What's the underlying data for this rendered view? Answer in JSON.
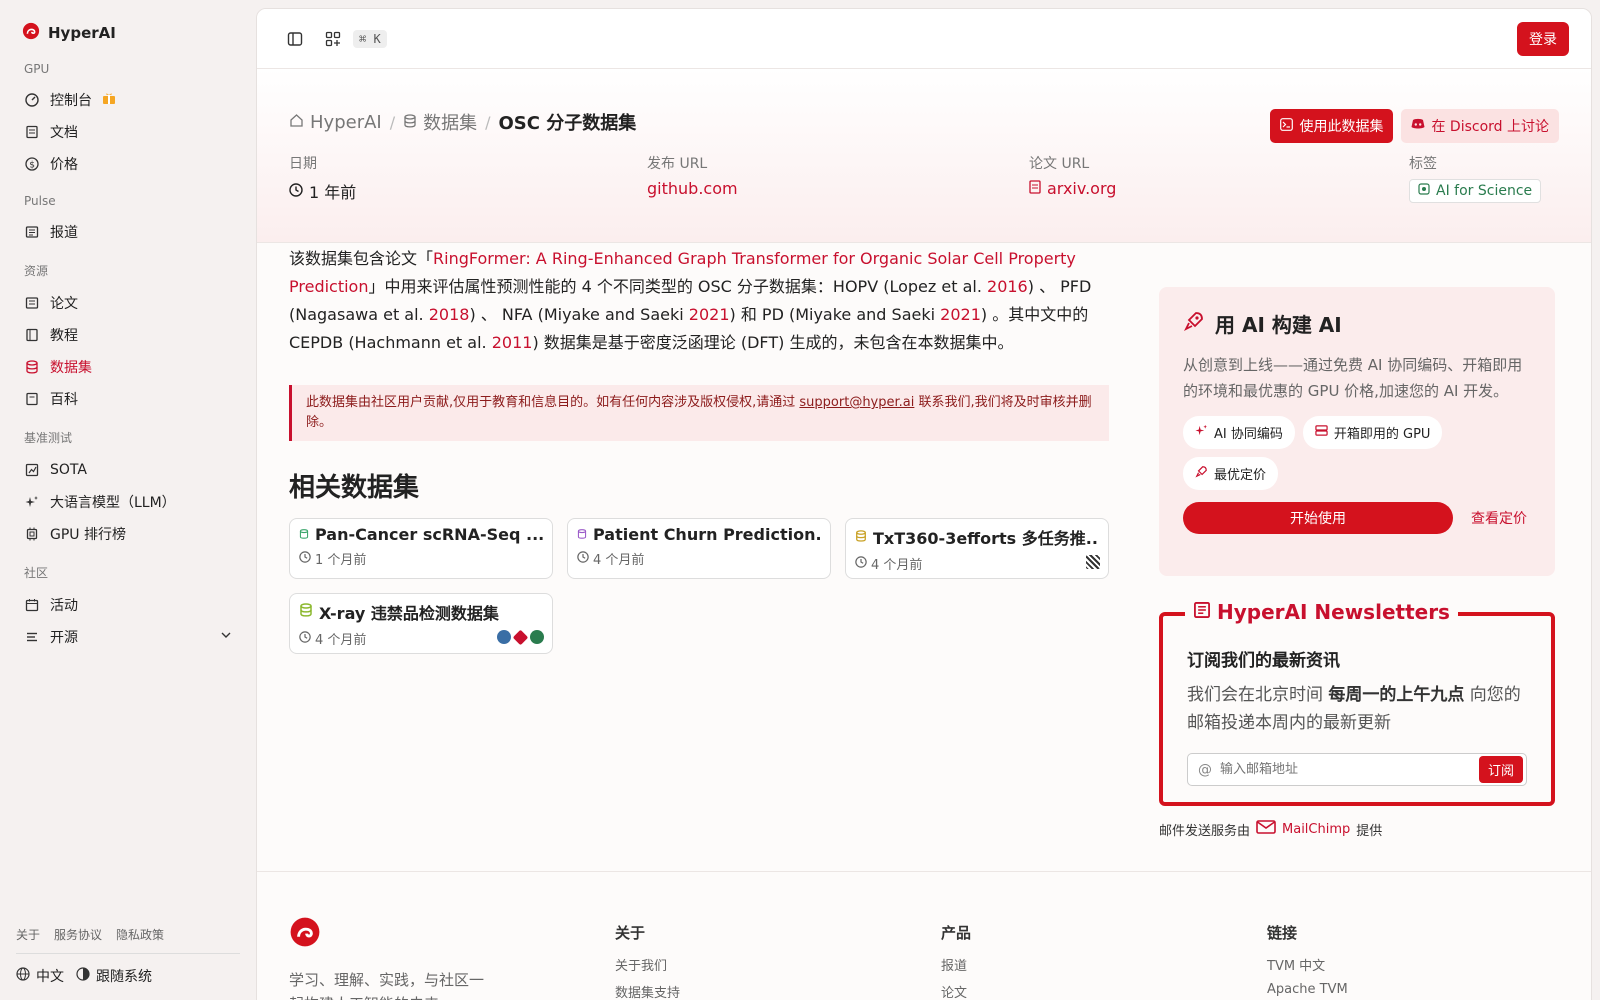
{
  "brand": {
    "name": "HyperAI"
  },
  "sidebar": {
    "sections": [
      {
        "title": "GPU",
        "items": [
          {
            "label": "控制台",
            "icon": "dashboard-icon"
          },
          {
            "label": "文档",
            "icon": "document-icon"
          },
          {
            "label": "价格",
            "icon": "dollar-icon"
          }
        ]
      },
      {
        "title": "Pulse",
        "items": [
          {
            "label": "报道",
            "icon": "newspaper-icon"
          }
        ]
      },
      {
        "title": "资源",
        "items": [
          {
            "label": "论文",
            "icon": "paper-icon"
          },
          {
            "label": "教程",
            "icon": "book-icon"
          },
          {
            "label": "数据集",
            "icon": "database-icon",
            "active": true
          },
          {
            "label": "百科",
            "icon": "encyclopedia-icon"
          }
        ]
      },
      {
        "title": "基准测试",
        "items": [
          {
            "label": "SOTA",
            "icon": "chart-icon"
          },
          {
            "label": "大语言模型（LLM）",
            "icon": "sparkle-icon"
          },
          {
            "label": "GPU 排行榜",
            "icon": "cpu-icon"
          }
        ]
      },
      {
        "title": "社区",
        "items": [
          {
            "label": "活动",
            "icon": "calendar-icon"
          },
          {
            "label": "开源",
            "icon": "list-icon"
          }
        ]
      }
    ],
    "footer_links": [
      "关于",
      "服务协议",
      "隐私政策"
    ],
    "language": "中文",
    "theme": "跟随系统"
  },
  "topbar": {
    "shortcut": "⌘ K",
    "login": "登录"
  },
  "breadcrumb": {
    "home": "HyperAI",
    "section": "数据集",
    "current": "OSC 分子数据集"
  },
  "actions": {
    "use": "使用此数据集",
    "discord": "在 Discord 上讨论"
  },
  "meta": {
    "date_label": "日期",
    "date_value": "1 年前",
    "release_label": "发布 URL",
    "release_value": "github.com",
    "paper_label": "论文 URL",
    "paper_value": "arxiv.org",
    "tag_label": "标签",
    "tag_value": "AI for Science"
  },
  "description": {
    "p1": "该数据集包含论文「",
    "paper_link": "RingFormer: A Ring-Enhanced Graph Transformer for Organic Solar Cell Property Prediction",
    "p2": "」中用来评估属性预测性能的 4 个不同类型的 OSC 分子数据集：HOPV (Lopez et al. ",
    "y1": "2016",
    "p3": ") 、 PFD (Nagasawa et al. ",
    "y2": "2018",
    "p4": ") 、 NFA (Miyake and Saeki ",
    "y3": "2021",
    "p5": ") 和 PD (Miyake and Saeki ",
    "y4": "2021",
    "p6": ") 。其中文中的 CEPDB  (Hachmann et al. ",
    "y5": "2011",
    "p7": ") 数据集是基于密度泛函理论 (DFT) 生成的，未包含在本数据集中。"
  },
  "notice": {
    "text1": "此数据集由社区用户贡献,仅用于教育和信息目的。如有任何内容涉及版权侵权,请通过 ",
    "email": "support@hyper.ai",
    "text2": " 联系我们,我们将及时审核并删除。"
  },
  "related": {
    "title": "相关数据集",
    "items": [
      {
        "title": "Pan-Cancer scRNA-Seq ...",
        "date": "1 个月前"
      },
      {
        "title": "Patient Churn Prediction...",
        "date": "4 个月前"
      },
      {
        "title": "TxT360-3efforts 多任务推...",
        "date": "4 个月前"
      },
      {
        "title": "X-ray 违禁品检测数据集",
        "date": "4 个月前"
      }
    ]
  },
  "promo": {
    "title": "用 AI 构建 AI",
    "desc": "从创意到上线——通过免费 AI 协同编码、开箱即用的环境和最优惠的 GPU 价格,加速您的 AI 开发。",
    "chips": [
      "AI 协同编码",
      "开箱即用的 GPU",
      "最优定价"
    ],
    "start": "开始使用",
    "pricing": "查看定价"
  },
  "newsletter": {
    "title": "HyperAI Newsletters",
    "subtitle": "订阅我们的最新资讯",
    "desc1": "我们会在北京时间 ",
    "desc_bold": "每周一的上午九点",
    "desc2": " 向您的邮箱投递本周内的最新更新",
    "placeholder": "输入邮箱地址",
    "subscribe": "订阅",
    "provider_prefix": "邮件发送服务由",
    "provider": "MailChimp",
    "provider_suffix": "提供"
  },
  "footer": {
    "tagline": "学习、理解、实践，与社区一起构建人工智能的未来",
    "col1": {
      "title": "关于",
      "items": [
        "关于我们",
        "数据集支持"
      ]
    },
    "col2": {
      "title": "产品",
      "items": [
        "报道",
        "论文"
      ]
    },
    "col3": {
      "title": "链接",
      "items": [
        "TVM 中文",
        "Apache TVM"
      ]
    }
  },
  "colors": {
    "accent": "#d4121d",
    "accent_light": "#fbecec"
  }
}
